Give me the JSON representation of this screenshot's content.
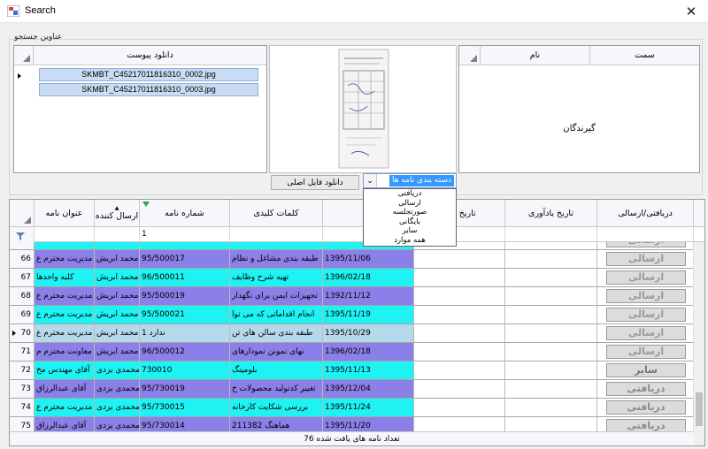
{
  "window": {
    "title": "Search"
  },
  "group": {
    "label": "عناوین جستجو"
  },
  "recipients": {
    "col_name": "نام",
    "col_position": "سمت",
    "center_text": "گیرندگان"
  },
  "attachments": {
    "header": "دانلود پیوست",
    "files": [
      "SKMBT_C45217011816310_0002.jpg",
      "SKMBT_C45217011816310_0003.jpg"
    ]
  },
  "preview": {
    "download_original": "دانلود فایل اصلی",
    "combo_value": "دسته بندی نامه ها"
  },
  "dropdown": {
    "options": [
      "دریافتی",
      "ارسالی",
      "صورتجلسه",
      "بایگانی",
      "سایر",
      "همه موارد"
    ]
  },
  "grid": {
    "columns": {
      "subject": "عنوان نامه",
      "sender": "ارسال کننده",
      "letter_no": "شماره نامه",
      "keywords": "کلمات کلیدی",
      "date": "نامه",
      "ref_date": "تاریخ پیرو",
      "reminder": "تاریخ یادآوری",
      "type": "دریافتی/ارسالی"
    },
    "filter_letter_no": "1",
    "rows": [
      {
        "n": "",
        "subject": "",
        "sender": "",
        "no": "",
        "keywords": "",
        "date": "",
        "type": "ارسالی",
        "color": "#1ef2f2"
      },
      {
        "n": "66",
        "subject": "مدیریت محترم ع",
        "sender": "محمد ابریش",
        "no": "95/500017",
        "keywords": "طبقه بندی مشاغل و نظام",
        "date": "1395/11/06",
        "type": "ارسالی",
        "color": "#8b7fe8"
      },
      {
        "n": "67",
        "subject": "کلیه واحدها",
        "sender": "محمد ابریش",
        "no": "96/500011",
        "keywords": "تهیه شرح وظایف",
        "date": "1396/02/18",
        "type": "ارسالی",
        "color": "#1ef2f2"
      },
      {
        "n": "68",
        "subject": "مدیریت محترم ع",
        "sender": "محمد ابریش",
        "no": "95/500019",
        "keywords": "تجهیزات ایمن برای نگهدار",
        "date": "1392/11/12",
        "type": "ارسالی",
        "color": "#8b7fe8"
      },
      {
        "n": "69",
        "subject": "مدیریت محترم ع",
        "sender": "محمد ابریش",
        "no": "95/500021",
        "keywords": "انجام اقداماتی که می توا",
        "date": "1395/11/19",
        "type": "ارسالی",
        "color": "#1ef2f2"
      },
      {
        "n": "70",
        "subject": "مدیریت محترم ع",
        "sender": "محمد ابریش",
        "no": "ندارد 1",
        "keywords": "طبقه بندی سالن های تن",
        "date": "1395/10/29",
        "type": "ارسالی",
        "color": "#b5d9ea",
        "selected": true
      },
      {
        "n": "71",
        "subject": "معاونت محترم م",
        "sender": "محمد ابریش",
        "no": "96/500012",
        "keywords": "نهای نمونن نمودارهای",
        "date": "1396/02/18",
        "type": "ارسالی",
        "color": "#8b7fe8"
      },
      {
        "n": "72",
        "subject": "آقای مهندس مخ",
        "sender": "محمدی یزدی",
        "no": "730010",
        "keywords": "بلومینگ",
        "date": "1395/11/13",
        "type": "سایر",
        "color": "#1ef2f2"
      },
      {
        "n": "73",
        "subject": "آقای عبدالرزاق",
        "sender": "محمدی یزدی",
        "no": "95/730019",
        "keywords": "تغییر کدتولید محصولات خ",
        "date": "1395/12/04",
        "type": "دریافتی",
        "color": "#8b7fe8"
      },
      {
        "n": "74",
        "subject": "مدیریت محترم ع",
        "sender": "محمدی یزدی",
        "no": "95/730015",
        "keywords": "بررسی شکایت کارخانه",
        "date": "1395/11/24",
        "type": "دریافتی",
        "color": "#1ef2f2"
      },
      {
        "n": "75",
        "subject": "آقای عبدالرزاق",
        "sender": "محمدی یزدی",
        "no": "95/730014",
        "keywords": "هماهنگ 211382",
        "date": "1395/11/20",
        "type": "دریافتی",
        "color": "#8b7fe8"
      }
    ],
    "status": "تعداد نامه های یافت شده 76"
  }
}
